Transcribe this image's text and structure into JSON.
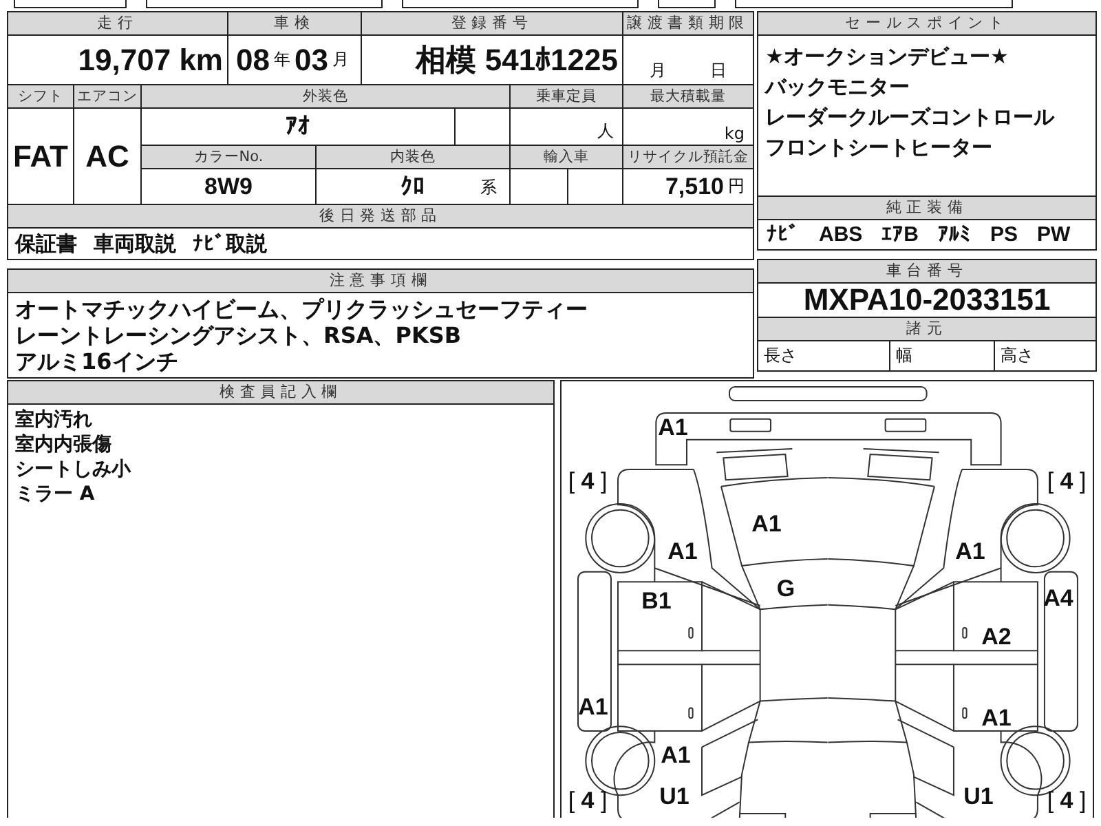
{
  "vehicle": {
    "mileage": {
      "label": "走行",
      "value": "19,707 km"
    },
    "inspection": {
      "label": "車検",
      "year": "08",
      "year_unit": "年",
      "month": "03",
      "month_unit": "月"
    },
    "registration": {
      "label": "登録番号",
      "value": "相模 541ﾎ1225"
    },
    "transfer_deadline": {
      "label": "譲渡書類期限",
      "month_unit": "月",
      "day_unit": "日"
    },
    "shift": {
      "label": "シフト",
      "value": "FAT"
    },
    "aircon": {
      "label": "エアコン",
      "value": "AC"
    },
    "exterior_color": {
      "label": "外装色",
      "value": "ｱｵ"
    },
    "capacity": {
      "label": "乗車定員",
      "unit": "人"
    },
    "max_load": {
      "label": "最大積載量",
      "unit": "kg"
    },
    "color_no": {
      "label": "カラーNo.",
      "value": "8W9"
    },
    "interior_color": {
      "label": "内装色",
      "value": "ｸﾛ",
      "suffix": "系"
    },
    "import_car": {
      "label": "輸入車"
    },
    "recycle_fee": {
      "label": "リサイクル預託金",
      "value": "7,510",
      "unit": "円"
    }
  },
  "parts_to_ship": {
    "label": "後日発送部品",
    "items": [
      "保証書",
      "車両取説",
      "ﾅﾋﾞ取説"
    ]
  },
  "notes": {
    "label": "注意事項欄",
    "lines": [
      "オートマチックハイビーム、プリクラッシュセーフティー",
      "レーントレーシングアシスト、RSA、PKSB",
      "アルミ16インチ"
    ]
  },
  "sales_points": {
    "label": "セールスポイント",
    "lines": [
      "★オークションデビュー★",
      "バックモニター",
      "レーダークルーズコントロール",
      "フロントシートヒーター"
    ]
  },
  "standard_equipment": {
    "label": "純正装備",
    "items": [
      "ﾅﾋﾞ",
      "ABS",
      "ｴｱB",
      "ｱﾙﾐ",
      "PS",
      "PW"
    ]
  },
  "chassis": {
    "label": "車台番号",
    "value": "MXPA10-2033151"
  },
  "specs": {
    "label": "諸元",
    "items": [
      "長さ",
      "幅",
      "高さ"
    ]
  },
  "inspector": {
    "label": "検査員記入欄",
    "lines": [
      "室内汚れ",
      "室内内張傷",
      "シートしみ小",
      "ミラー A"
    ]
  },
  "damage_map": {
    "marks": {
      "front_bumper": "A1",
      "hood": "A1",
      "front_left_fender": "A1",
      "front_right_fender": "A1",
      "windshield": "G",
      "front_left_door": "B1",
      "right_side_sill": "A4",
      "front_right_door": "A2",
      "left_side_sill": "A1",
      "rear_right_door": "A1",
      "rear_left_fender": "A1",
      "rear_left_corner": "U1",
      "rear_right_corner": "U1"
    },
    "tires": {
      "front_left": "[ **4** ]",
      "front_right": "[ **4** ]",
      "rear_left": "[ **4** ]",
      "rear_right": "[ **4** ]"
    }
  }
}
